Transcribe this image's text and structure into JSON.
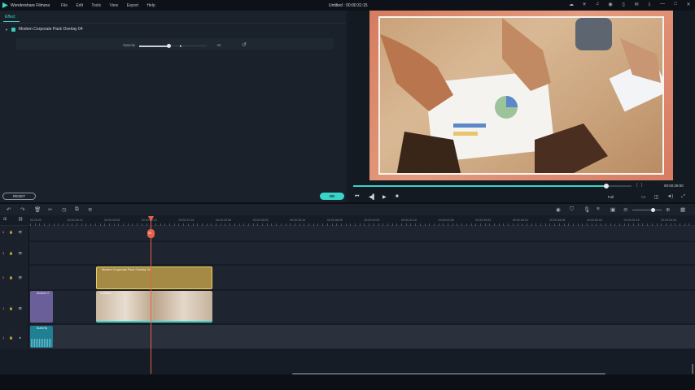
{
  "titlebar": {
    "app_name": "Wondershare Filmora",
    "menu": [
      "File",
      "Edit",
      "Tools",
      "View",
      "Export",
      "Help"
    ],
    "document_title": "Untitled : 00:00:31:15"
  },
  "effect_panel": {
    "tab_label": "Effect",
    "effect_name": "Modern Corporate Pack Overlay 04",
    "opacity_label": "Opacity",
    "opacity_value": "44",
    "opacity_percent": 44,
    "reset_label": "RESET",
    "ok_label": "OK"
  },
  "preview": {
    "time": "00:00:29:00",
    "progress_fraction": 0.91,
    "quality": "Full"
  },
  "timeline": {
    "ruler_labels": [
      "00:25:00",
      "00:00:26:14",
      "00:00:28:08",
      "00:00:30:03",
      "00:00:31:18",
      "00:00:33:08",
      "00:00:35:00",
      "00:00:36:16",
      "00:00:38:06",
      "00:00:40:00",
      "00:00:41:16",
      "00:00:43:08",
      "00:00:45:00",
      "00:00:46:16",
      "00:00:48:08",
      "00:00:50:00",
      "00:00:51:16",
      "00:00:53:08"
    ],
    "playhead_label": "00",
    "clips": {
      "overlay": "Modern Corporate Pack Overlay 04",
      "video": "Untitled",
      "title": "Modern C",
      "audio": "Butterfly"
    },
    "track_numbers": [
      "4",
      "3",
      "2",
      "1",
      "1"
    ]
  },
  "colors": {
    "accent": "#39d3c8",
    "playhead": "#e8604a",
    "overlay_clip": "#a48a45",
    "title_clip": "#6b5f9a",
    "audio_clip": "#1f7f93"
  }
}
